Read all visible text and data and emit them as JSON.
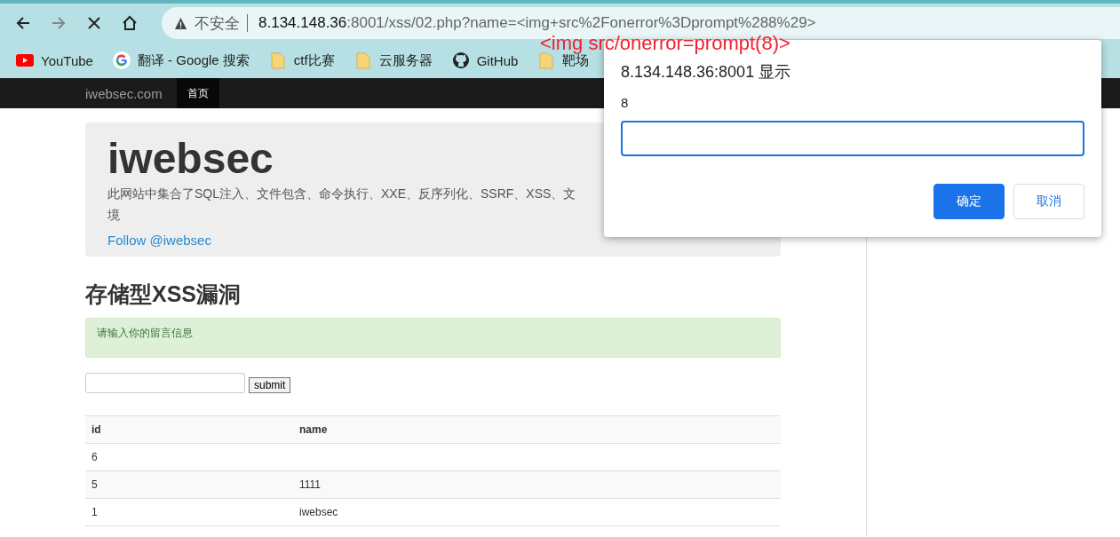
{
  "browser": {
    "address_bar": {
      "security_label": "不安全",
      "host": "8.134.148.36",
      "path": ":8001/xss/02.php?name=<img+src%2Fonerror%3Dprompt%288%29>"
    },
    "bookmarks": [
      {
        "kind": "youtube",
        "label": "YouTube"
      },
      {
        "kind": "google",
        "label": "翻译 - Google 搜索"
      },
      {
        "kind": "folder",
        "label": "ctf比赛"
      },
      {
        "kind": "folder",
        "label": "云服务器"
      },
      {
        "kind": "github",
        "label": "GitHub"
      },
      {
        "kind": "folder",
        "label": "靶场"
      }
    ]
  },
  "annotation": "<img src/onerror=prompt(8)>",
  "navbar": {
    "brand": "iwebsec.com",
    "items": [
      {
        "label": "首页",
        "selected": true
      }
    ]
  },
  "jumbotron": {
    "title": "iwebsec",
    "description_lines": [
      "此网站中集合了SQL注入、文件包含、命令执行、XXE、反序列化、SSRF、XSS、文",
      "境"
    ],
    "link": "Follow @iwebsec"
  },
  "heading": "存储型XSS漏洞",
  "alert": "请输入你的留言信息",
  "form": {
    "submit": "submit"
  },
  "table": {
    "columns": [
      "id",
      "name"
    ],
    "rows": [
      [
        "6",
        ""
      ],
      [
        "5",
        "1111"
      ],
      [
        "1",
        "iwebsec"
      ]
    ]
  },
  "dialog": {
    "title": "8.134.148.36:8001 显示",
    "message": "8",
    "buttons": [
      {
        "label": "确定",
        "kind": "primary"
      },
      {
        "label": "取消",
        "kind": "secondary"
      }
    ]
  }
}
